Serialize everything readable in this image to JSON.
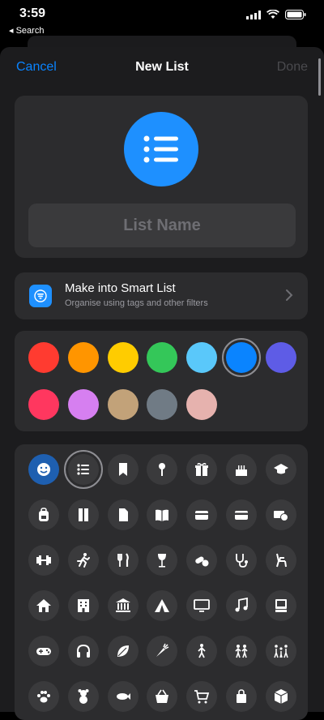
{
  "status": {
    "time": "3:59",
    "back_label": "◂ Search"
  },
  "nav": {
    "cancel": "Cancel",
    "title": "New List",
    "done": "Done"
  },
  "list_name": {
    "placeholder": "List Name"
  },
  "smart_list": {
    "title": "Make into Smart List",
    "subtitle": "Organise using tags and other filters"
  },
  "colors": {
    "row1": [
      "#ff3b30",
      "#ff9500",
      "#ffcc00",
      "#34c759",
      "#5ac8fa",
      "#0a84ff",
      "#5e5ce6"
    ],
    "row2": [
      "#ff375f",
      "#d67ff0",
      "#c2a279",
      "#707b85",
      "#e6b2ae"
    ],
    "selected": "#0a84ff"
  },
  "icons": [
    [
      "smiley-icon",
      "list-icon",
      "bookmark-icon",
      "pin-icon",
      "gift-icon",
      "cake-icon",
      "graduation-cap-icon"
    ],
    [
      "backpack-icon",
      "ruler-icon",
      "document-icon",
      "book-icon",
      "wallet-icon",
      "credit-card-icon",
      "money-icon"
    ],
    [
      "dumbbell-icon",
      "running-icon",
      "fork-knife-icon",
      "wine-glass-icon",
      "pills-icon",
      "stethoscope-icon",
      "chair-icon"
    ],
    [
      "house-icon",
      "building-icon",
      "bank-icon",
      "tent-icon",
      "monitor-icon",
      "music-note-icon",
      "computer-icon"
    ],
    [
      "gamepad-icon",
      "headphones-icon",
      "leaf-icon",
      "carrot-icon",
      "person-icon",
      "two-people-icon",
      "family-icon"
    ],
    [
      "paw-icon",
      "teddy-bear-icon",
      "fish-icon",
      "basket-icon",
      "cart-icon",
      "bag-icon",
      "box-icon"
    ]
  ],
  "selected_icon": "list-icon"
}
